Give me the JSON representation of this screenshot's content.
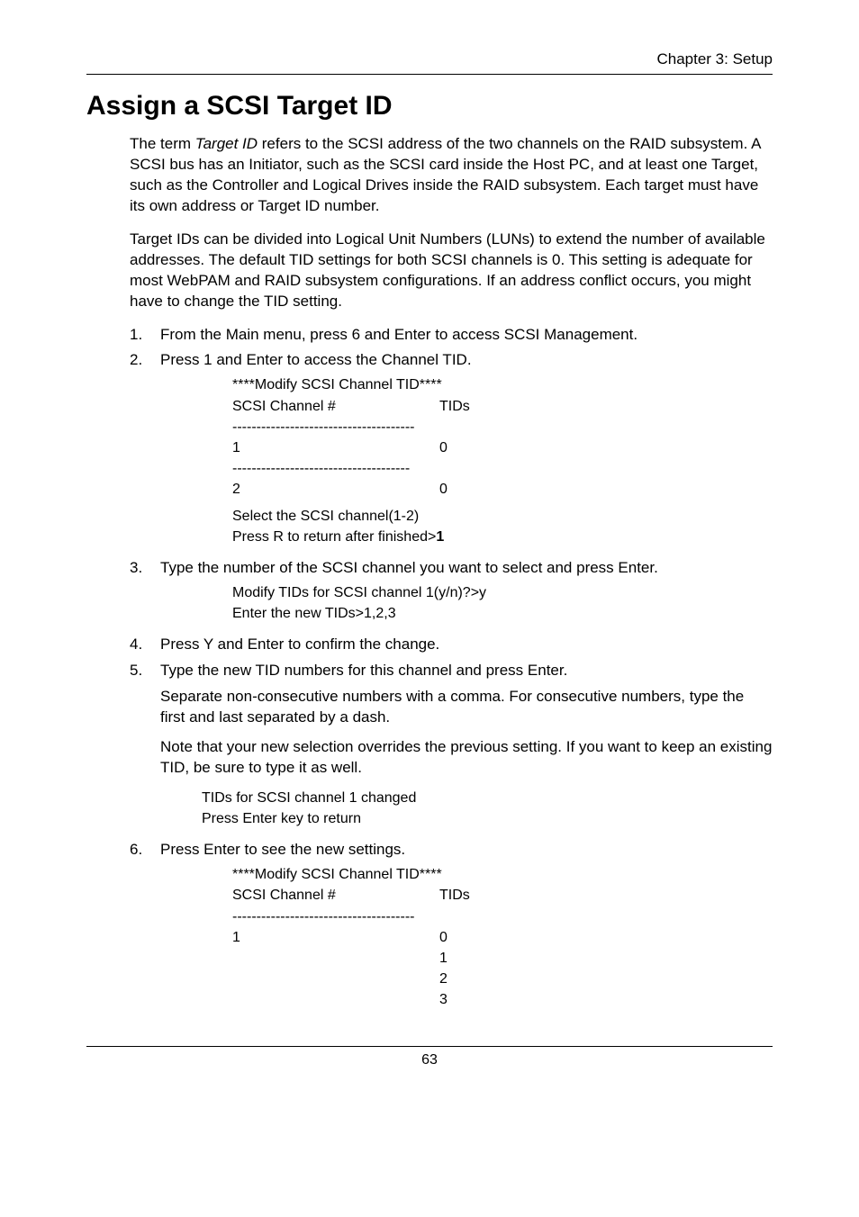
{
  "header": {
    "chapter": "Chapter 3: Setup"
  },
  "title": "Assign a SCSI Target ID",
  "intro": {
    "p1a": "The term ",
    "p1_italic": "Target ID",
    "p1b": " refers to the SCSI address of the two channels on the RAID subsystem. A SCSI bus has an Initiator, such as the SCSI card inside the Host PC, and at least one Target, such as the Controller and Logical Drives inside the RAID subsystem. Each target must have its own address or Target ID number.",
    "p2": "Target IDs can be divided into Logical Unit Numbers (LUNs) to extend the number of available addresses. The default TID settings for both SCSI channels is 0. This setting is adequate for most WebPAM and RAID subsystem configurations. If an address conflict occurs, you might have to change the TID setting."
  },
  "steps": {
    "s1_num": "1.",
    "s1": "From the Main menu, press 6 and Enter to access SCSI Management.",
    "s2_num": "2.",
    "s2": "Press 1 and Enter to access the Channel TID.",
    "s2_block": {
      "l1": "****Modify SCSI Channel TID****",
      "l2_left": "SCSI Channel #",
      "l2_right": "TIDs",
      "rule": "--------------------------------------",
      "r1_left": "1",
      "r1_right": "0",
      "rule2": "-------------------------------------",
      "r2_left": "2",
      "r2_right": "0",
      "sel": "Select the SCSI channel(1-2)",
      "press": "Press R to return after finished>",
      "press_bold": "1"
    },
    "s3_num": "3.",
    "s3": "Type the number of the SCSI channel you want to select and press Enter.",
    "s3_block": {
      "l1": "Modify TIDs for SCSI channel 1(y/n)?>y",
      "l2": "Enter the new TIDs>1,2,3"
    },
    "s4_num": "4.",
    "s4": "Press Y and Enter to confirm the change.",
    "s5_num": "5.",
    "s5": "Type the new TID numbers for this channel and press Enter.",
    "s5_sub1": "Separate non-consecutive numbers with a comma. For consecutive numbers, type the first and last separated by a dash.",
    "s5_sub2": "Note that your new selection overrides the previous setting. If you want to keep an existing TID, be sure to type it as well.",
    "s5_block": {
      "l1": "TIDs for SCSI channel 1 changed",
      "l2": "Press Enter key to return"
    },
    "s6_num": "6.",
    "s6": "Press Enter to see the new settings.",
    "s6_block": {
      "l1": "****Modify SCSI Channel TID****",
      "l2_left": "SCSI Channel #",
      "l2_right": "TIDs",
      "rule": "--------------------------------------",
      "r1_left": "1",
      "r1_right": "0",
      "r2_right": "1",
      "r3_right": "2",
      "r4_right": "3"
    }
  },
  "footer": {
    "page": "63"
  }
}
